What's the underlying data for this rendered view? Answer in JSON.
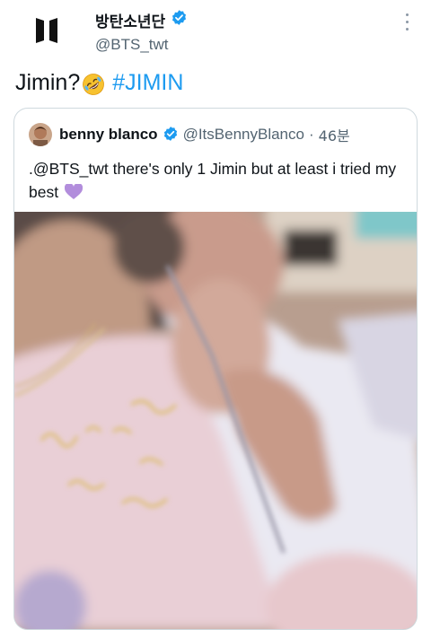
{
  "author": {
    "display_name": "방탄소년단",
    "handle": "@BTS_twt",
    "verified_icon": "verified-badge-icon",
    "logo_icon": "bts-logo-icon",
    "more_icon": "more-dots-icon"
  },
  "tweet": {
    "text_before": "Jimin?",
    "emoji": "rolling-on-floor-laughing-emoji",
    "hashtag": "#JIMIN"
  },
  "quoted": {
    "display_name": "benny blanco",
    "handle": "@ItsBennyBlanco",
    "separator": "·",
    "time": "46분",
    "text": ".@BTS_twt there's only 1 Jimin but at least i tried my best",
    "emoji": "purple-heart-emoji",
    "media": "blurry-selfie-photo"
  },
  "colors": {
    "accent": "#1d9bf0",
    "secondary_text": "#536471",
    "border": "#cfd9de"
  }
}
